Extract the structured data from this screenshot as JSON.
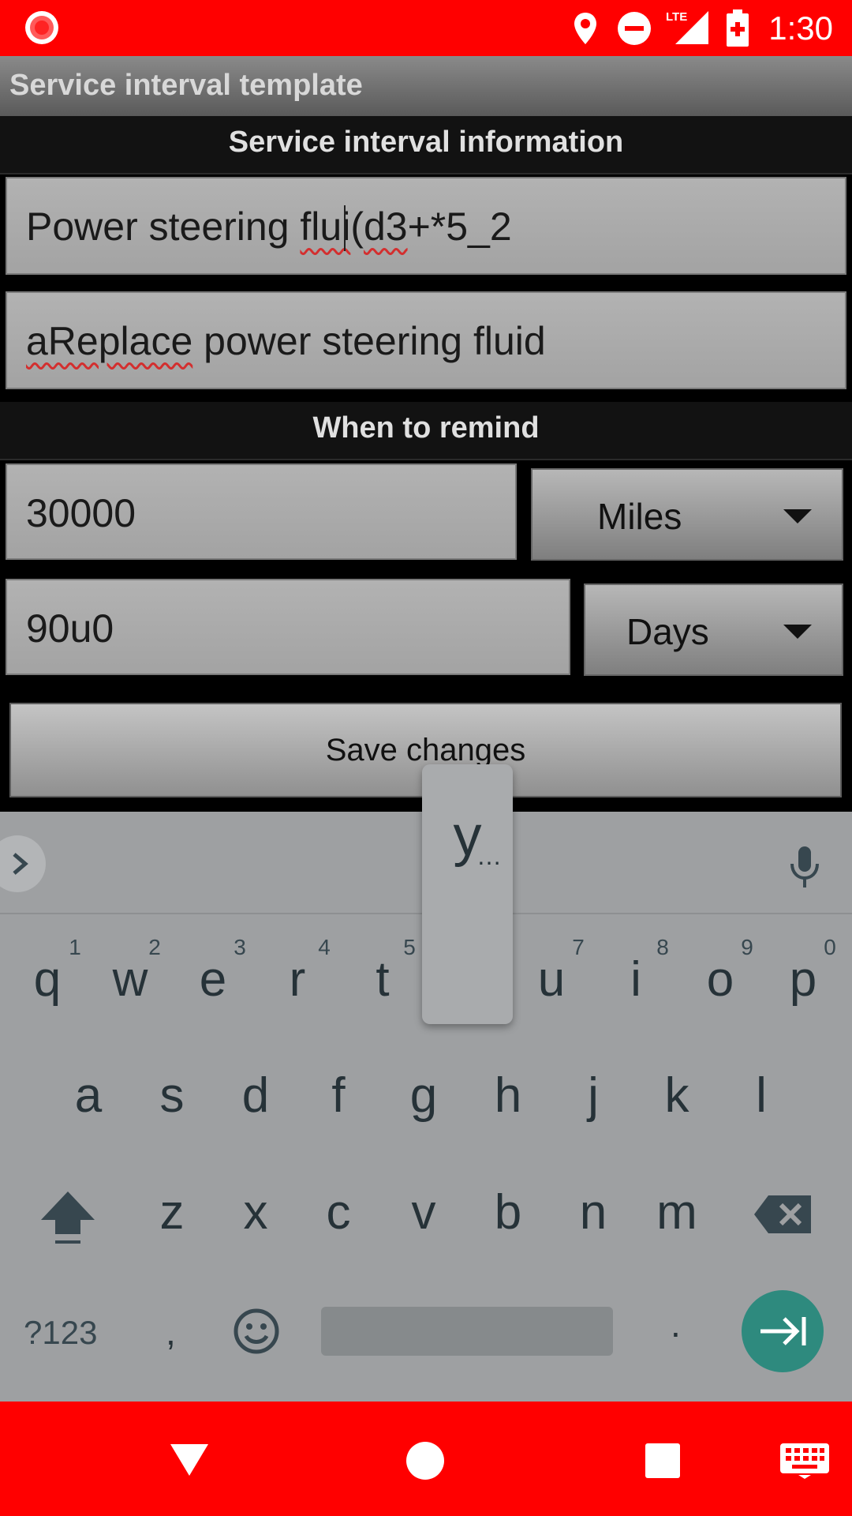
{
  "status_bar": {
    "time": "1:30",
    "network": "LTE",
    "icons": [
      "screen-record-icon",
      "location-icon",
      "do-not-disturb-icon",
      "lte-signal-icon",
      "battery-charging-icon"
    ],
    "background": "#ff0000"
  },
  "app_bar": {
    "title": "Service interval template"
  },
  "sections": {
    "info_title": "Service interval information",
    "remind_title": "When to remind"
  },
  "form": {
    "name_field": {
      "value_prefix": "Power steering ",
      "value_misspelled_1": "flui",
      "value_mid": "(",
      "value_misspelled_2": "d3",
      "value_suffix": "+*5_2"
    },
    "description_field": {
      "value_misspelled": "aReplace",
      "value_rest": " power steering fluid"
    },
    "distance_field": {
      "value": "30000"
    },
    "distance_unit": {
      "selected": "Miles"
    },
    "time_field": {
      "value": "90u0"
    },
    "time_unit": {
      "selected": "Days"
    },
    "save_label": "Save changes"
  },
  "keyboard": {
    "popup_letter": "y",
    "popup_more": "…",
    "row1": [
      {
        "key": "q",
        "hint": "1"
      },
      {
        "key": "w",
        "hint": "2"
      },
      {
        "key": "e",
        "hint": "3"
      },
      {
        "key": "r",
        "hint": "4"
      },
      {
        "key": "t",
        "hint": "5"
      },
      {
        "key": "u",
        "hint": "7"
      },
      {
        "key": "i",
        "hint": "8"
      },
      {
        "key": "o",
        "hint": "9"
      },
      {
        "key": "p",
        "hint": "0"
      }
    ],
    "row2": [
      "a",
      "s",
      "d",
      "f",
      "g",
      "h",
      "j",
      "k",
      "l"
    ],
    "row3": [
      "z",
      "x",
      "c",
      "v",
      "b",
      "n",
      "m"
    ],
    "symbols_label": "?123",
    "comma": ",",
    "period": ".",
    "accent_color": "#2e8a7e"
  },
  "nav_bar": {
    "icons": [
      "back-icon",
      "home-icon",
      "recents-icon",
      "keyboard-switch-icon"
    ]
  }
}
